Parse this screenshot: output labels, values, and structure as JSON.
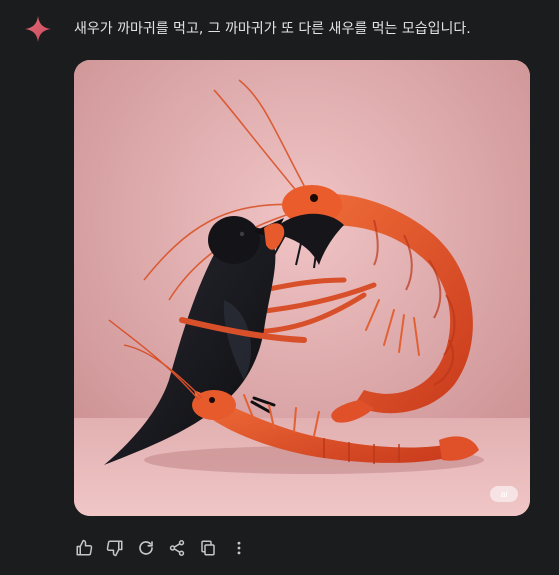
{
  "message": {
    "text": "새우가 까마귀를 먹고, 그 까마귀가 또 다른 새우를 먹는 모습입니다."
  },
  "image": {
    "badge_label": "ai",
    "colors": {
      "background": "#dca5a6",
      "floor": "#e8b8b8",
      "shrimp": "#e8552a",
      "crow": "#151518"
    }
  },
  "actions": [
    {
      "icon": "thumbs-up-icon"
    },
    {
      "icon": "thumbs-down-icon"
    },
    {
      "icon": "regenerate-icon"
    },
    {
      "icon": "share-icon"
    },
    {
      "icon": "copy-icon"
    },
    {
      "icon": "more-vertical-icon"
    }
  ],
  "theme": {
    "background": "#1b1c1d",
    "text": "#e3e3e3",
    "icon": "#c4c7c5",
    "sparkle": "#d96570"
  }
}
